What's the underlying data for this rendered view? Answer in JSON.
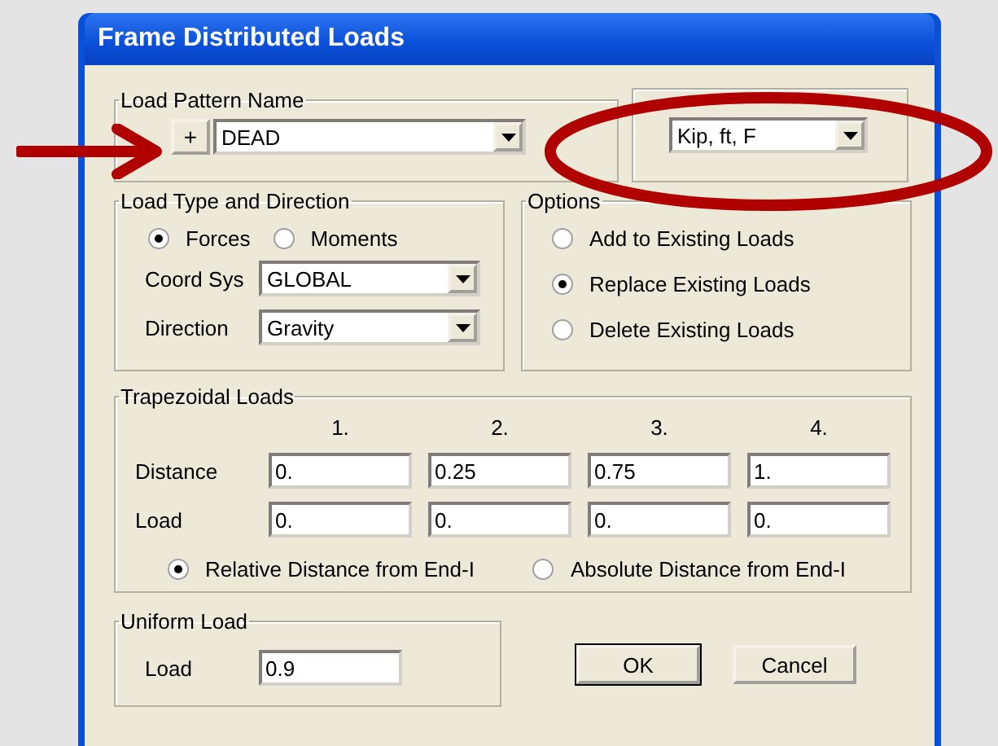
{
  "window": {
    "title": "Frame Distributed Loads"
  },
  "load_pattern": {
    "label": "Load Pattern Name",
    "add_button": "+",
    "value": "DEAD"
  },
  "units": {
    "value": "Kip, ft, F"
  },
  "load_type": {
    "label": "Load Type and Direction",
    "types": [
      {
        "label": "Forces",
        "selected": true
      },
      {
        "label": "Moments",
        "selected": false
      }
    ],
    "coord_sys": {
      "label": "Coord Sys",
      "value": "GLOBAL"
    },
    "direction": {
      "label": "Direction",
      "value": "Gravity"
    }
  },
  "options": {
    "label": "Options",
    "items": [
      {
        "label": "Add to Existing Loads",
        "selected": false
      },
      {
        "label": "Replace Existing Loads",
        "selected": true
      },
      {
        "label": "Delete Existing Loads",
        "selected": false
      }
    ]
  },
  "trapezoidal": {
    "label": "Trapezoidal Loads",
    "columns": [
      "1.",
      "2.",
      "3.",
      "4."
    ],
    "rows": [
      {
        "label": "Distance",
        "values": [
          "0.",
          "0.25",
          "0.75",
          "1."
        ]
      },
      {
        "label": "Load",
        "values": [
          "0.",
          "0.",
          "0.",
          "0."
        ]
      }
    ],
    "modes": [
      {
        "label": "Relative Distance from End-I",
        "selected": true
      },
      {
        "label": "Absolute Distance from End-I",
        "selected": false
      }
    ]
  },
  "uniform": {
    "label": "Uniform Load",
    "load_label": "Load",
    "value": "0.9"
  },
  "buttons": [
    {
      "label": "OK",
      "default": true
    },
    {
      "label": "Cancel",
      "default": false
    }
  ]
}
